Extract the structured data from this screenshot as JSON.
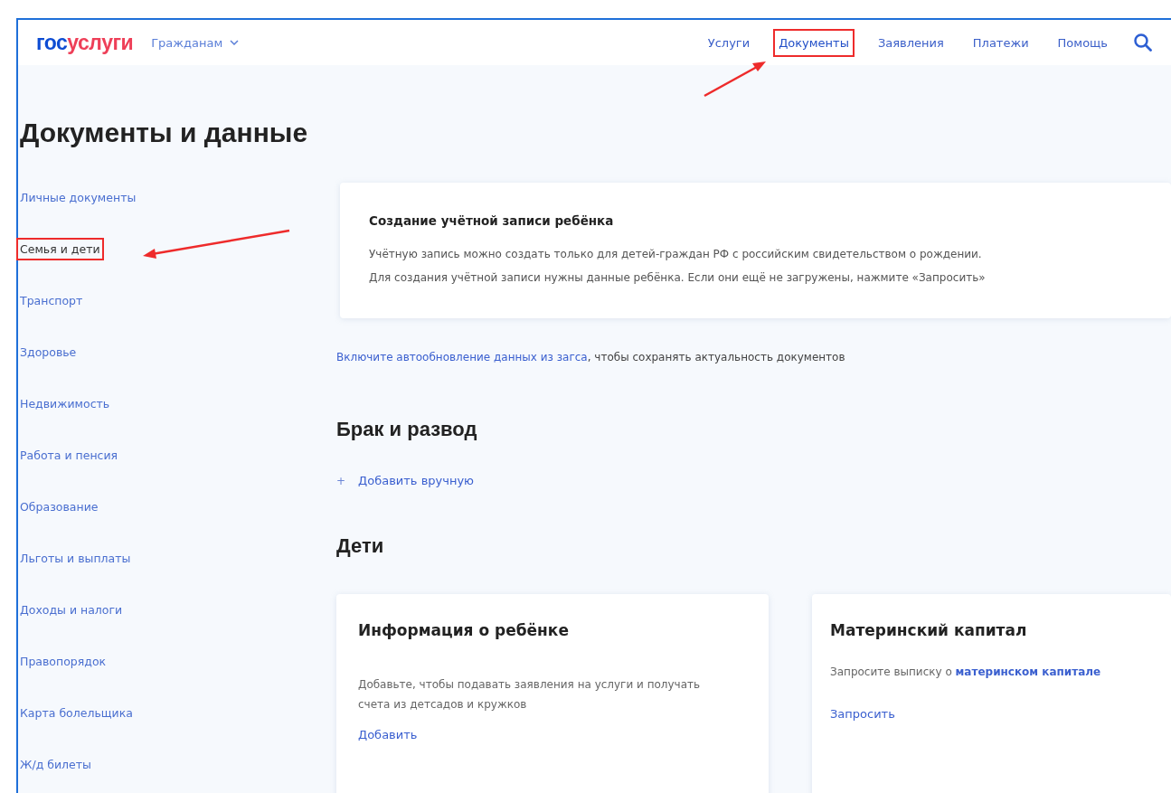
{
  "header": {
    "logo": {
      "prefix": "гос",
      "suffix": "услуги"
    },
    "audience": "Гражданам",
    "nav": [
      {
        "label": "Услуги",
        "selected": false,
        "highlighted": false
      },
      {
        "label": "Документы",
        "selected": true,
        "highlighted": true
      },
      {
        "label": "Заявления",
        "selected": false,
        "highlighted": false
      },
      {
        "label": "Платежи",
        "selected": false,
        "highlighted": false
      },
      {
        "label": "Помощь",
        "selected": false,
        "highlighted": false
      }
    ]
  },
  "title": "Документы и данные",
  "sidebar": {
    "items": [
      {
        "label": "Личные документы",
        "selected": false,
        "highlighted": false
      },
      {
        "label": "Семья и дети",
        "selected": true,
        "highlighted": true
      },
      {
        "label": "Транспорт",
        "selected": false,
        "highlighted": false
      },
      {
        "label": "Здоровье",
        "selected": false,
        "highlighted": false
      },
      {
        "label": "Недвижимость",
        "selected": false,
        "highlighted": false
      },
      {
        "label": "Работа и пенсия",
        "selected": false,
        "highlighted": false
      },
      {
        "label": "Образование",
        "selected": false,
        "highlighted": false
      },
      {
        "label": "Льготы и выплаты",
        "selected": false,
        "highlighted": false
      },
      {
        "label": "Доходы и налоги",
        "selected": false,
        "highlighted": false
      },
      {
        "label": "Правопорядок",
        "selected": false,
        "highlighted": false
      },
      {
        "label": "Карта болельщика",
        "selected": false,
        "highlighted": false
      },
      {
        "label": "Ж/д билеты",
        "selected": false,
        "highlighted": false
      }
    ]
  },
  "notice": {
    "title": "Создание учётной записи ребёнка",
    "lines": [
      "Учётную запись можно создать только для детей-граждан РФ с российским свидетельством о рождении.",
      "Для создания учётной записи нужны данные ребёнка. Если они ещё не загружены, нажмите «Запросить»"
    ]
  },
  "autoupdate": {
    "link": "Включите автообновление данных из загса",
    "text": ", чтобы сохранять актуальность документов"
  },
  "marriage": {
    "heading": "Брак и развод",
    "add_icon": "+",
    "add_link": "Добавить вручную"
  },
  "children": {
    "heading": "Дети",
    "cards": [
      {
        "title": "Информация о ребёнке",
        "text": "Добавьте, чтобы подавать заявления на услуги и получать счета из детсадов и кружков",
        "link": "Добавить"
      },
      {
        "title": "Материнский капитал",
        "text": "Запросите выписку о ",
        "text_link": "материнском капитале",
        "link": "Запросить"
      }
    ]
  }
}
